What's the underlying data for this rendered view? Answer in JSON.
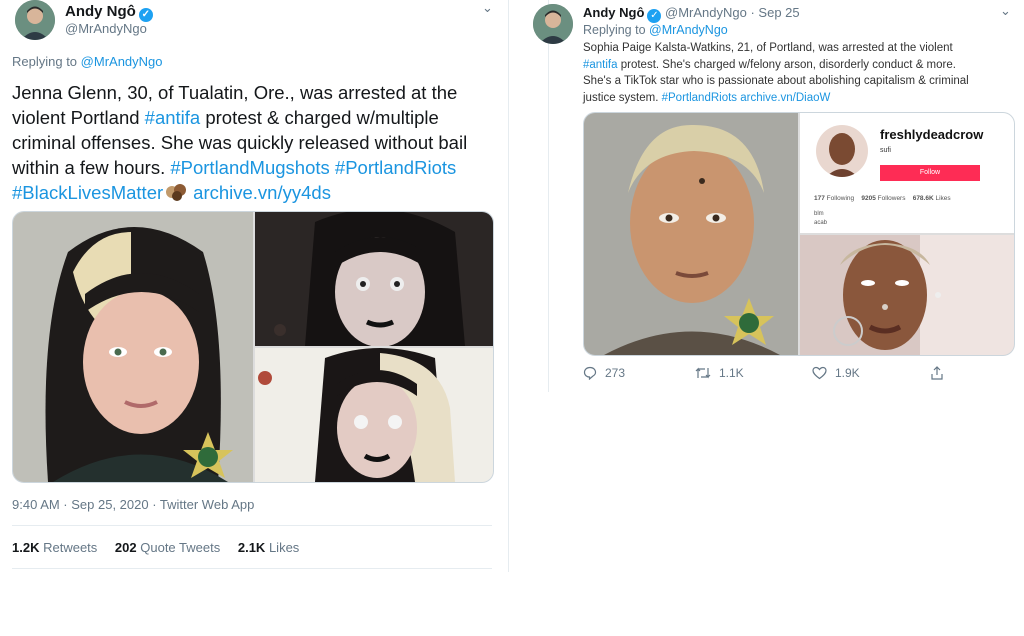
{
  "left_tweet": {
    "author_name": "Andy Ngô",
    "author_handle": "@MrAndyNgo",
    "replying_prefix": "Replying to",
    "replying_handle": "@MrAndyNgo",
    "text_1": "Jenna Glenn, 30, of Tualatin, Ore., was arrested at the\nviolent Portland ",
    "hashtag_antifa": "#antifa",
    "text_2": " protest & charged w/multiple\ncriminal offenses. She was quickly released without bail\nwithin a few hours. ",
    "hashtag_mugshots": "#PortlandMugshots",
    "hashtag_riots": "#PortlandRiots",
    "hashtag_blm": "#BlackLivesMatter",
    "archive_link": "archive.vn/yy4ds",
    "timestamp": "9:40 AM · Sep 25, 2020 · Twitter Web App",
    "retweets_count": "1.2K",
    "retweets_label": "Retweets",
    "quotes_count": "202",
    "quotes_label": "Quote Tweets",
    "likes_count": "2.1K",
    "likes_label": "Likes"
  },
  "right_tweet": {
    "author_name": "Andy Ngô",
    "author_handle": "@MrAndyNgo",
    "date": "· Sep 25",
    "replying_prefix": "Replying to",
    "replying_handle": "@MrAndyNgo",
    "text_1": "Sophia Paige Kalsta-Watkins, 21, of Portland, was arrested at the violent\n",
    "hashtag_antifa": "#antifa",
    "text_2": " protest. She's charged w/felony arson, disorderly conduct & more.\nShe's a TikTok star who is passionate about abolishing capitalism & criminal\njustice system. ",
    "hashtag_riots": "#PortlandRiots",
    "archive_link": "archive.vn/DiaoW",
    "tiktok": {
      "username": "freshlydeadcrow",
      "display_name": "sufi",
      "follow_label": "Follow",
      "following_count": "177",
      "following_label": "Following",
      "followers_count": "9205",
      "followers_label": "Followers",
      "likes_count": "678.6K",
      "likes_label": "Likes",
      "bio_line1": "blm",
      "bio_line2": "acab"
    },
    "reply_count": "273",
    "retweet_count": "1.1K",
    "like_count": "1.9K"
  },
  "colors": {
    "accent": "#1da1f2",
    "link": "#1b95e0",
    "tiktok_red": "#fe2c55"
  }
}
